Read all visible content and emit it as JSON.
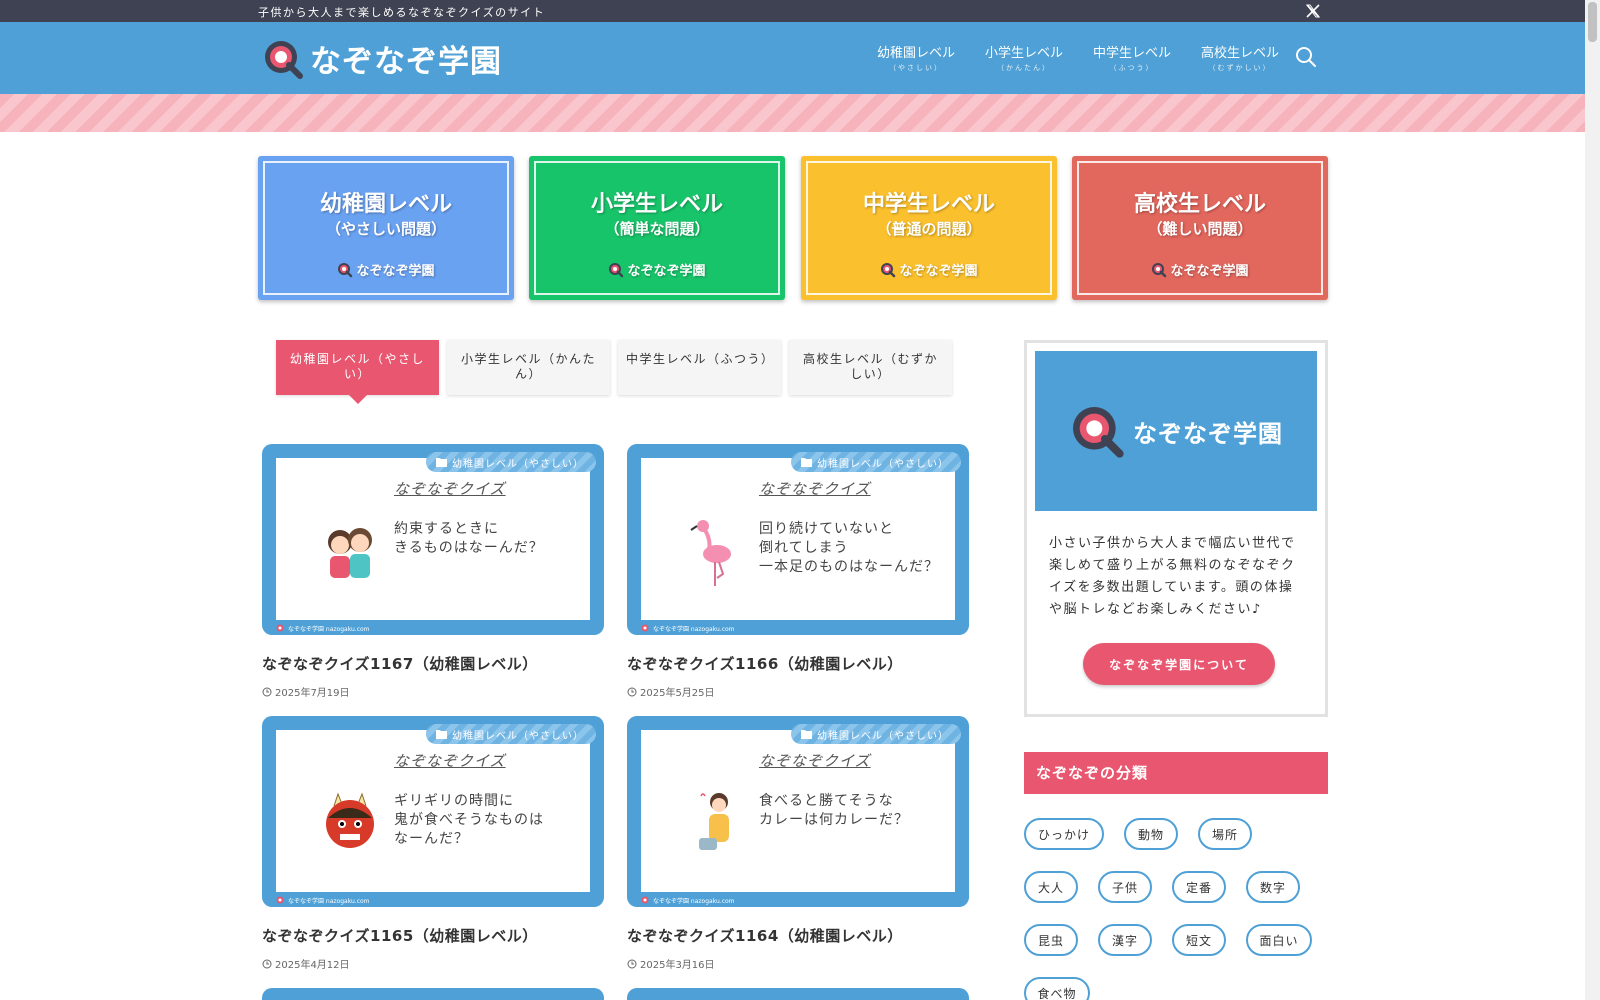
{
  "topbar": {
    "tagline": "子供から大人まで楽しめるなぞなぞクイズのサイト"
  },
  "header": {
    "logo_text": "なぞなぞ学園",
    "nav": [
      {
        "label": "幼稚園レベル",
        "sub": "（やさしい）"
      },
      {
        "label": "小学生レベル",
        "sub": "（かんたん）"
      },
      {
        "label": "中学生レベル",
        "sub": "（ふつう）"
      },
      {
        "label": "高校生レベル",
        "sub": "（むずかしい）"
      }
    ]
  },
  "banners": [
    {
      "title": "幼稚園レベル",
      "sub": "（やさしい問題）",
      "brand": "なぞなぞ学園",
      "color": "#6aa2f2"
    },
    {
      "title": "小学生レベル",
      "sub": "（簡単な問題）",
      "brand": "なぞなぞ学園",
      "color": "#18c46a"
    },
    {
      "title": "中学生レベル",
      "sub": "（普通の問題）",
      "brand": "なぞなぞ学園",
      "color": "#fbc02d"
    },
    {
      "title": "高校生レベル",
      "sub": "（難しい問題）",
      "brand": "なぞなぞ学園",
      "color": "#e2675d"
    }
  ],
  "tabs": [
    {
      "label": "幼稚園レベル（やさしい）"
    },
    {
      "label": "小学生レベル（かんたん）"
    },
    {
      "label": "中学生レベル（ふつう）"
    },
    {
      "label": "高校生レベル（むずかしい）"
    }
  ],
  "cards": [
    {
      "category": "幼稚園レベル（やさしい）",
      "quiz_head": "なぞなぞクイズ",
      "question": "約束するときに\nきるものはなーんだ？",
      "footer": "なぞなぞ学園 nazogaku.com",
      "title": "なぞなぞクイズ1167（幼稚園レベル）",
      "date": "2025年7月19日"
    },
    {
      "category": "幼稚園レベル（やさしい）",
      "quiz_head": "なぞなぞクイズ",
      "question": "回り続けていないと\n倒れてしまう\n一本足のものはなーんだ？",
      "footer": "なぞなぞ学園 nazogaku.com",
      "title": "なぞなぞクイズ1166（幼稚園レベル）",
      "date": "2025年5月25日"
    },
    {
      "category": "幼稚園レベル（やさしい）",
      "quiz_head": "なぞなぞクイズ",
      "question": "ギリギリの時間に\n鬼が食べそうなものは\nなーんだ？",
      "footer": "なぞなぞ学園 nazogaku.com",
      "title": "なぞなぞクイズ1165（幼稚園レベル）",
      "date": "2025年4月12日"
    },
    {
      "category": "幼稚園レベル（やさしい）",
      "quiz_head": "なぞなぞクイズ",
      "question": "食べると勝てそうな\nカレーは何カレーだ？",
      "footer": "なぞなぞ学園 nazogaku.com",
      "title": "なぞなぞクイズ1164（幼稚園レベル）",
      "date": "2025年3月16日"
    }
  ],
  "sidebar": {
    "banner_text": "なぞなぞ学園",
    "description": "小さい子供から大人まで幅広い世代で楽しめて盛り上がる無料のなぞなぞクイズを多数出題しています。頭の体操や脳トレなどお楽しみください♪",
    "about_button": "なぞなぞ学園について",
    "classification_heading": "なぞなぞの分類",
    "tags": [
      "ひっかけ",
      "動物",
      "場所",
      "大人",
      "子供",
      "定番",
      "数字",
      "昆虫",
      "漢字",
      "短文",
      "面白い",
      "食べ物"
    ]
  },
  "colors": {
    "header_blue": "#4ea0d6",
    "accent_pink": "#e9566f",
    "topbar": "#3f4252"
  },
  "icons": {
    "x": "x-logo-icon",
    "search": "search-icon",
    "folder": "folder-icon",
    "clock": "clock-icon",
    "logo": "magnifier-q-logo-icon"
  }
}
